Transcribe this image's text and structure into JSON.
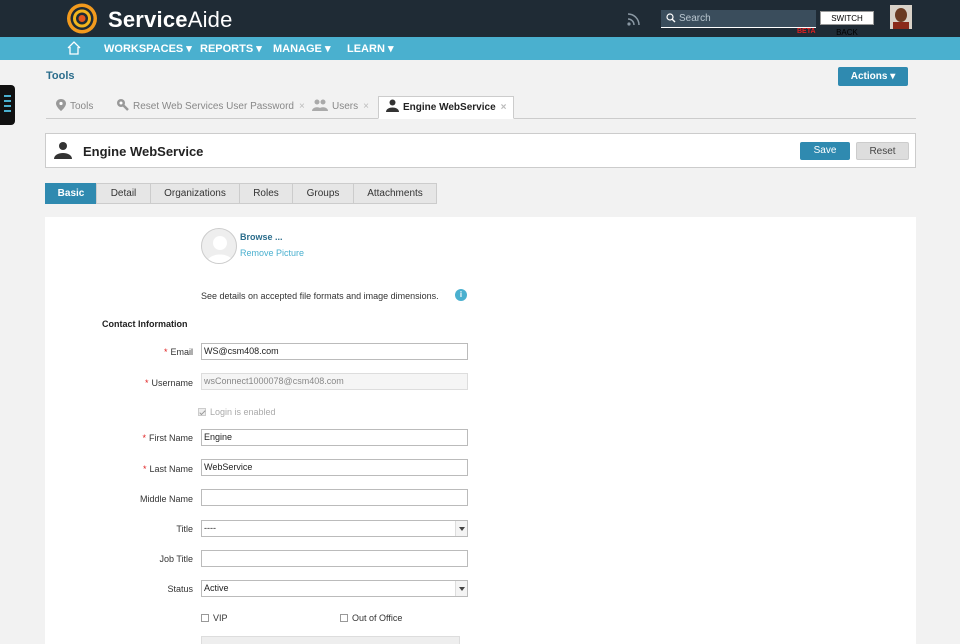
{
  "topbar": {
    "brand_bold": "Service",
    "brand_light": "Aide",
    "search_placeholder": "Search",
    "beta": "BETA",
    "switch_back": "SWITCH BACK"
  },
  "nav": {
    "items": [
      {
        "label": "WORKSPACES ▾"
      },
      {
        "label": "REPORTS ▾"
      },
      {
        "label": "MANAGE ▾"
      },
      {
        "label": "LEARN ▾"
      }
    ]
  },
  "page": {
    "section_title": "Tools",
    "actions_label": "Actions ▾"
  },
  "tabs": [
    {
      "label": "Tools",
      "icon": "location-pin-icon",
      "closable": false
    },
    {
      "label": "Reset Web Services User Password",
      "icon": "wrench-icon",
      "closable": true
    },
    {
      "label": "Users",
      "icon": "users-icon",
      "closable": true
    },
    {
      "label": "Engine WebService",
      "icon": "user-icon",
      "closable": true,
      "active": true
    }
  ],
  "tab_close": "×",
  "header": {
    "title": "Engine WebService",
    "save": "Save",
    "reset": "Reset"
  },
  "subtabs": [
    {
      "label": "Basic",
      "active": true
    },
    {
      "label": "Detail"
    },
    {
      "label": "Organizations"
    },
    {
      "label": "Roles"
    },
    {
      "label": "Groups"
    },
    {
      "label": "Attachments"
    }
  ],
  "picture": {
    "browse": "Browse ...",
    "remove": "Remove Picture",
    "details": "See details on accepted file formats and image dimensions.",
    "info": "i"
  },
  "form": {
    "section": "Contact Information",
    "required_mark": "*",
    "email": {
      "label": "Email",
      "value": "WS@csm408.com"
    },
    "username": {
      "label": "Username",
      "value": "wsConnect1000078@csm408.com"
    },
    "login_enabled": "Login is enabled",
    "first_name": {
      "label": "First Name",
      "value": "Engine"
    },
    "last_name": {
      "label": "Last Name",
      "value": "WebService"
    },
    "middle_name": {
      "label": "Middle Name",
      "value": ""
    },
    "title": {
      "label": "Title",
      "value": "----"
    },
    "job_title": {
      "label": "Job Title",
      "value": ""
    },
    "status": {
      "label": "Status",
      "value": "Active"
    },
    "vip": "VIP",
    "out_of_office": "Out of Office"
  },
  "colors": {
    "topbar": "#1f2b35",
    "navbar": "#4ab0cf",
    "primary_button": "#2f8ab0",
    "required": "#e02020"
  }
}
